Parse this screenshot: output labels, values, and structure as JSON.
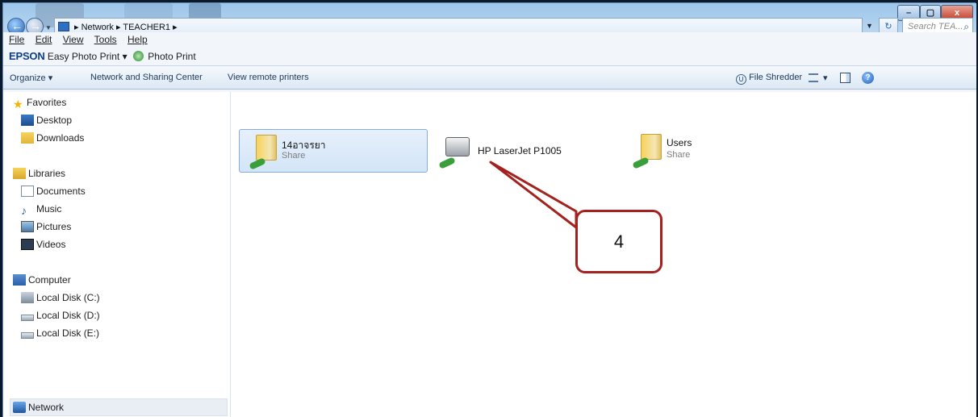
{
  "window": {
    "controls": {
      "minimize": "–",
      "maximize": "▢",
      "close": "x"
    }
  },
  "address": {
    "crumbs": "▸ Network ▸ TEACHER1 ▸",
    "search_placeholder": "Search TEA..."
  },
  "menu": {
    "file": "File",
    "edit": "Edit",
    "view": "View",
    "tools": "Tools",
    "help": "Help"
  },
  "epson": {
    "brand": "EPSON",
    "easy_photo_print": "Easy Photo Print",
    "photo_print": "Photo Print"
  },
  "command_bar": {
    "organize": "Organize ▾",
    "network_sharing": "Network and Sharing Center",
    "view_remote_printers": "View remote printers",
    "file_shredder": "File Shredder"
  },
  "nav": {
    "favorites": "Favorites",
    "desktop": "Desktop",
    "downloads": "Downloads",
    "libraries": "Libraries",
    "documents": "Documents",
    "music": "Music",
    "pictures": "Pictures",
    "videos": "Videos",
    "computer": "Computer",
    "disk_c": "Local Disk (C:)",
    "disk_d": "Local Disk (D:)",
    "disk_e": "Local Disk (E:)",
    "network": "Network"
  },
  "items": [
    {
      "name": "14อาจรยา",
      "sub": "Share",
      "icon": "shared-folder-icon"
    },
    {
      "name": "HP LaserJet P1005",
      "sub": "",
      "icon": "network-printer-icon"
    },
    {
      "name": "Users",
      "sub": "Share",
      "icon": "shared-folder-icon"
    }
  ],
  "callout": {
    "label": "4",
    "color": "#a3221f"
  }
}
